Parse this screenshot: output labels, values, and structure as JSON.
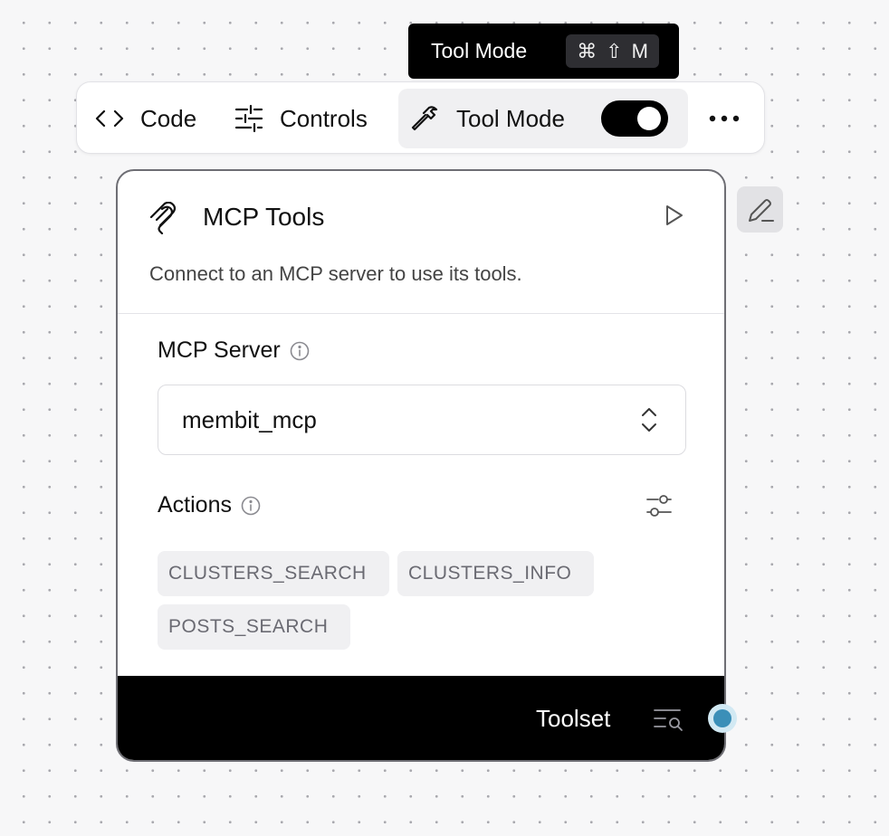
{
  "tooltip": {
    "label": "Tool Mode",
    "shortcut_cmd": "⌘",
    "shortcut_shift": "⇧",
    "shortcut_key": "M"
  },
  "toolbar": {
    "code_label": "Code",
    "controls_label": "Controls",
    "tool_mode_label": "Tool Mode",
    "tool_mode_on": true
  },
  "node": {
    "title": "MCP Tools",
    "description": "Connect to an MCP server to use its tools.",
    "server_label": "MCP Server",
    "server_value": "membit_mcp",
    "actions_label": "Actions",
    "actions": [
      "CLUSTERS_SEARCH",
      "CLUSTERS_INFO",
      "POSTS_SEARCH"
    ],
    "output_label": "Toolset"
  },
  "colors": {
    "handle": "#3b8fb8",
    "footer_bg": "#000000",
    "node_border": "#6e6e74"
  }
}
